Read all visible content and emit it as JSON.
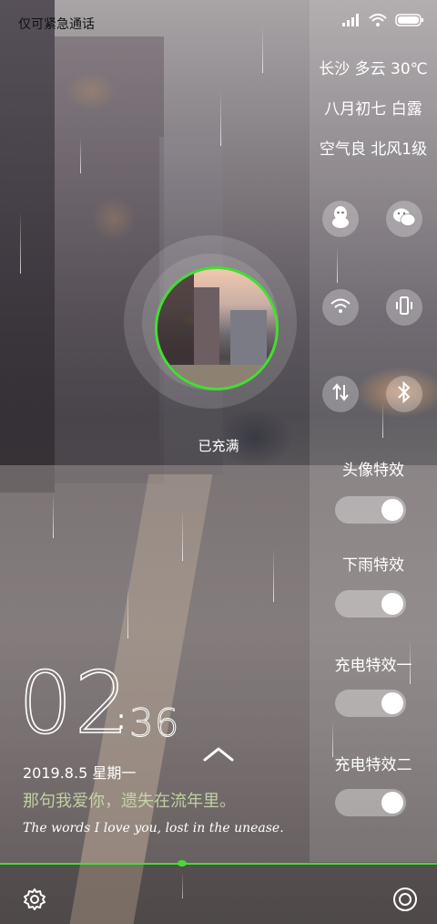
{
  "status_bar": {
    "carrier_text": "仅可紧急通话",
    "icons": [
      "signal-icon",
      "wifi-icon",
      "battery-icon"
    ]
  },
  "weather": {
    "line1": "长沙 多云 30℃",
    "line2": "八月初七 白露",
    "line3": "空气良 北风1级"
  },
  "quick_icons": [
    "qq-icon",
    "wechat-icon",
    "wifi-icon",
    "vibrate-icon",
    "data-transfer-icon",
    "bluetooth-icon"
  ],
  "charging": {
    "status_text": "已充满",
    "ring_color": "#44dd33"
  },
  "effects": [
    {
      "label": "头像特效",
      "on": true
    },
    {
      "label": "下雨特效",
      "on": true
    },
    {
      "label": "充电特效一",
      "on": true
    },
    {
      "label": "充电特效二",
      "on": true
    }
  ],
  "clock": {
    "hours": "02",
    "separator": ":",
    "minutes": "36"
  },
  "date_line": "2019.8.5   星期一",
  "quote_cn": "那句我爱你，遗失在流年里。",
  "quote_en": "The words I love you, lost in the unease.",
  "bottom": {
    "icons": [
      "settings-icon",
      "camera-icon"
    ],
    "accent_color": "#44dd33"
  }
}
